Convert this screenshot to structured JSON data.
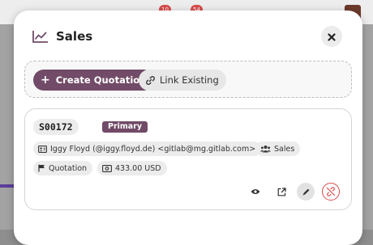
{
  "background": {
    "badges": [
      "10",
      "54"
    ]
  },
  "modal": {
    "title": "Sales",
    "close_icon": "close-icon",
    "actions": {
      "create_label": "Create Quotation",
      "link_label": "Link Existing"
    },
    "record": {
      "reference": "S00172",
      "badge": "Primary",
      "contact": "Iggy Floyd (@iggy.floyd.de) <gitlab@mg.gitlab.com>",
      "team": "Sales",
      "type": "Quotation",
      "amount": "433.00 USD",
      "row_actions": [
        "eye-icon",
        "external-link-icon",
        "pencil-icon",
        "unlink-icon"
      ]
    }
  },
  "colors": {
    "accent": "#714b67",
    "danger": "#d94c4c"
  }
}
